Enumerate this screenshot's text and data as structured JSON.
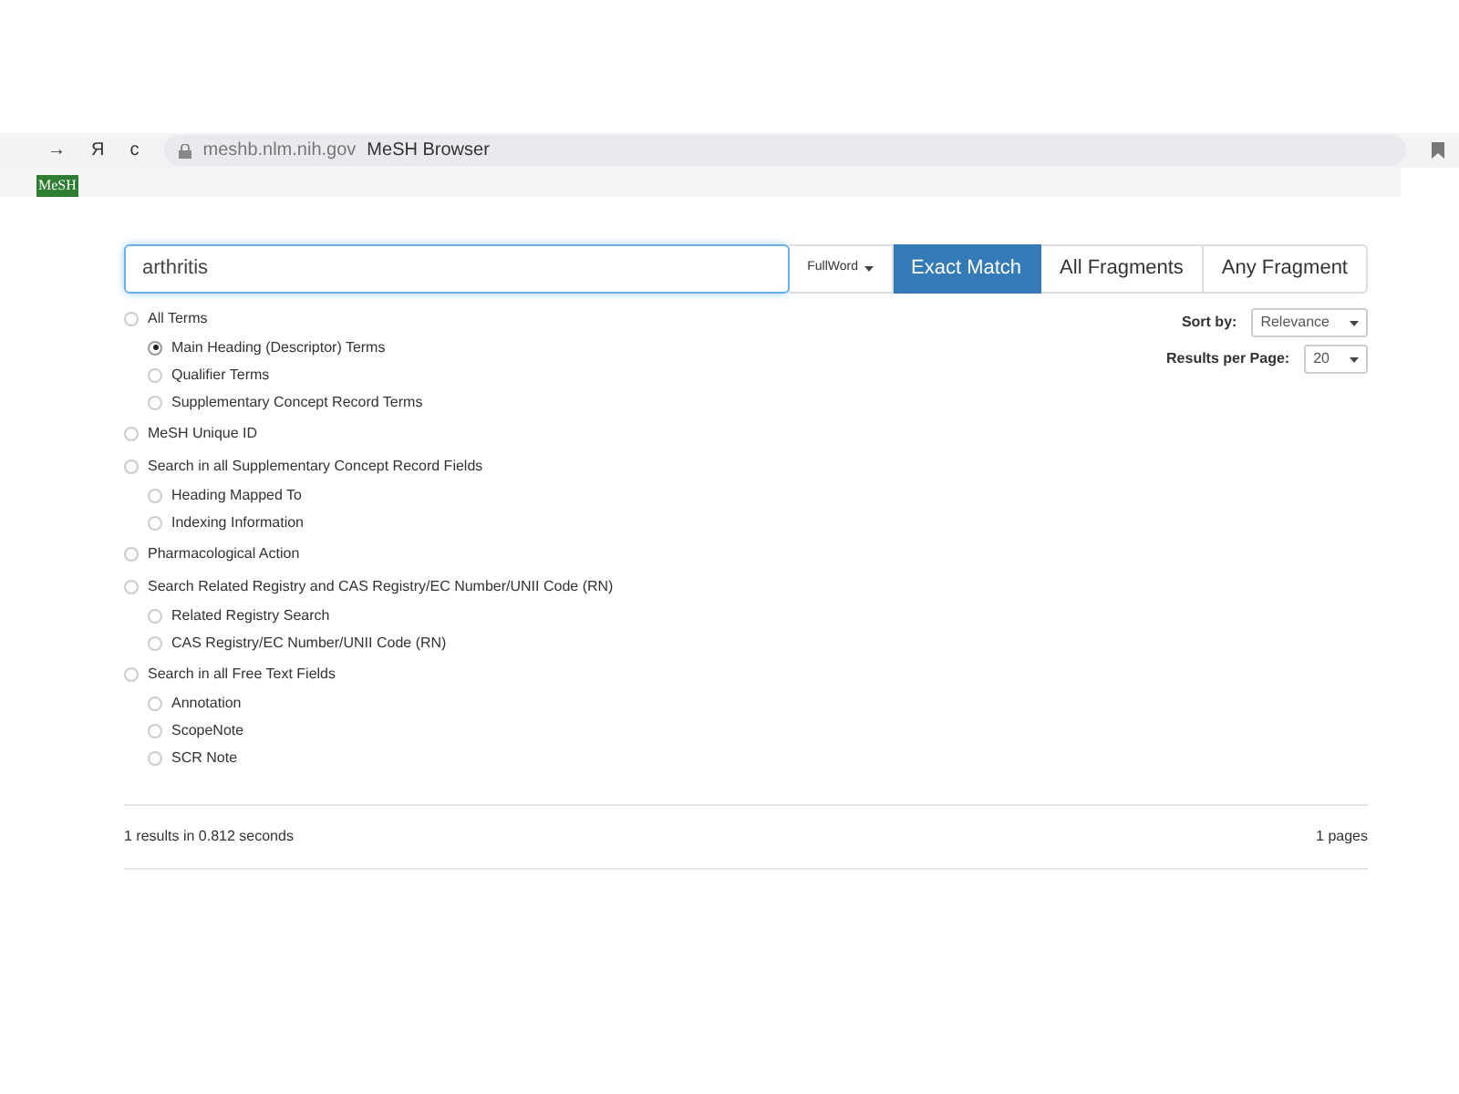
{
  "browser": {
    "back": "→",
    "home": "Я",
    "reload": "c",
    "url": "meshb.nlm.nih.gov",
    "title": "MeSH Browser"
  },
  "logo": "MeSH",
  "search": {
    "value": "arthritis",
    "mode": "FullWord"
  },
  "match_buttons": [
    {
      "label": "Exact Match",
      "selected": true
    },
    {
      "label": "All Fragments",
      "selected": false
    },
    {
      "label": "Any Fragment",
      "selected": false
    }
  ],
  "sort": {
    "label": "Sort by:",
    "value": "Relevance"
  },
  "per_page": {
    "label": "Results per Page:",
    "value": "20"
  },
  "options": [
    {
      "label": "All Terms",
      "selected": false,
      "children": [
        {
          "label": "Main Heading (Descriptor) Terms",
          "selected": true
        },
        {
          "label": "Qualifier Terms",
          "selected": false
        },
        {
          "label": "Supplementary Concept Record Terms",
          "selected": false
        }
      ]
    },
    {
      "label": "MeSH Unique ID",
      "selected": false
    },
    {
      "label": "Search in all Supplementary Concept Record Fields",
      "selected": false,
      "children": [
        {
          "label": "Heading Mapped To",
          "selected": false
        },
        {
          "label": "Indexing Information",
          "selected": false
        }
      ]
    },
    {
      "label": "Pharmacological Action",
      "selected": false
    },
    {
      "label": "Search Related Registry and CAS Registry/EC Number/UNII Code (RN)",
      "selected": false,
      "children": [
        {
          "label": "Related Registry Search",
          "selected": false
        },
        {
          "label": "CAS Registry/EC Number/UNII Code (RN)",
          "selected": false
        }
      ]
    },
    {
      "label": "Search in all Free Text Fields",
      "selected": false,
      "children": [
        {
          "label": "Annotation",
          "selected": false
        },
        {
          "label": "ScopeNote",
          "selected": false
        },
        {
          "label": "SCR Note",
          "selected": false
        }
      ]
    }
  ],
  "results": {
    "summary": "1 results in 0.812 seconds",
    "pages": "1 pages"
  }
}
